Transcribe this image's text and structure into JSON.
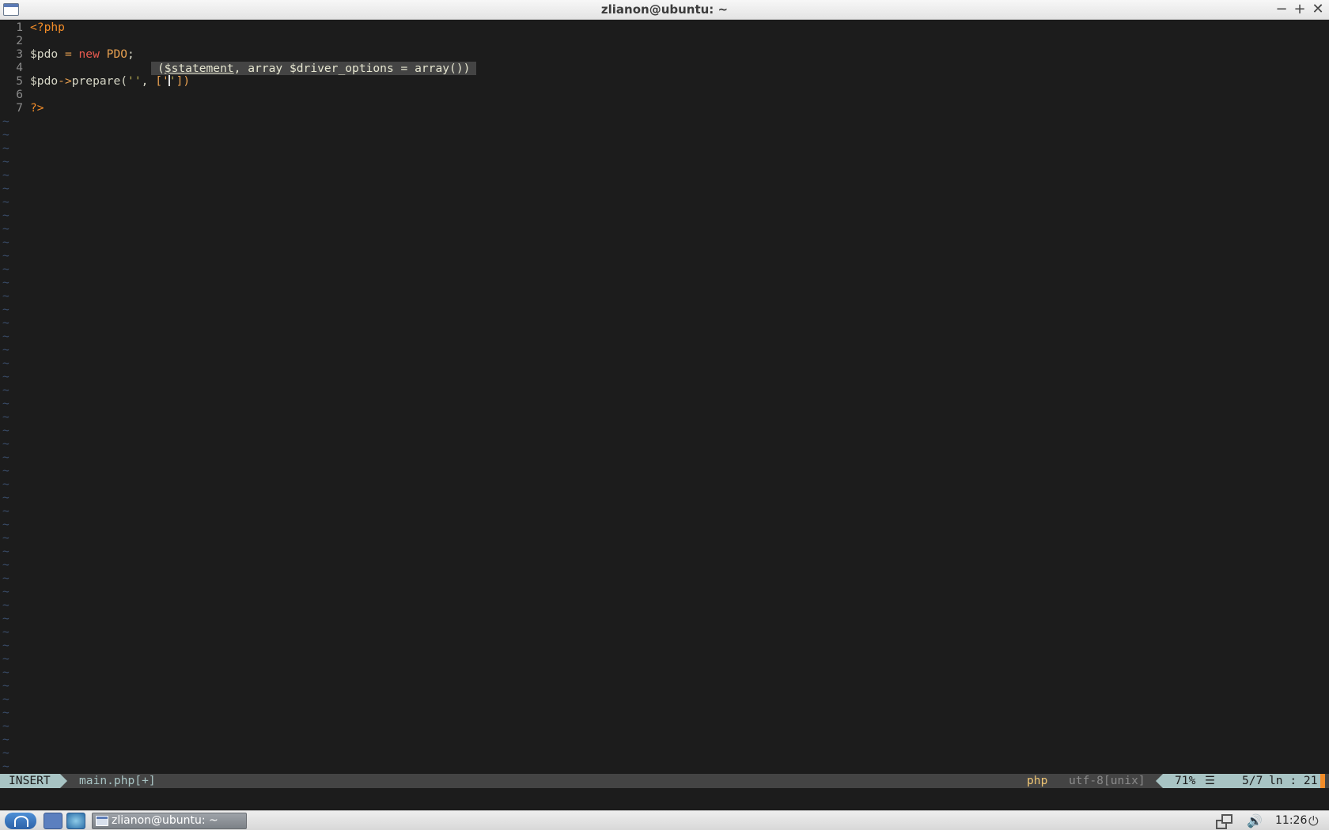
{
  "window": {
    "title": "zlianon@ubuntu: ~",
    "minimize": "−",
    "maximize": "+",
    "close": "✕"
  },
  "editor": {
    "lines": [
      {
        "num": "1",
        "tokens": [
          {
            "t": "<?php",
            "c": "kw-tag"
          }
        ]
      },
      {
        "num": "2",
        "tokens": []
      },
      {
        "num": "3",
        "tokens": [
          {
            "t": "$pdo",
            "c": "var"
          },
          {
            "t": " = ",
            "c": "op"
          },
          {
            "t": "new",
            "c": "kw-new"
          },
          {
            "t": " ",
            "c": "plain"
          },
          {
            "t": "PDO",
            "c": "cls"
          },
          {
            "t": ";",
            "c": "plain"
          }
        ]
      },
      {
        "num": "4",
        "tokens": []
      },
      {
        "num": "5",
        "tokens": [
          {
            "t": "$pdo",
            "c": "var"
          },
          {
            "t": "->",
            "c": "op"
          },
          {
            "t": "prepare",
            "c": "plain"
          },
          {
            "t": "(",
            "c": "plain"
          },
          {
            "t": "''",
            "c": "str"
          },
          {
            "t": ", ",
            "c": "plain"
          },
          {
            "t": "['",
            "c": "brk"
          },
          {
            "t": "CURSOR",
            "c": "cursor"
          },
          {
            "t": "'",
            "c": "str"
          },
          {
            "t": "])",
            "c": "brk"
          }
        ]
      },
      {
        "num": "6",
        "tokens": []
      },
      {
        "num": "7",
        "tokens": [
          {
            "t": "?>",
            "c": "kw-tag"
          }
        ]
      }
    ],
    "empty_marker": "~",
    "signature_hint": {
      "open": "(",
      "active_param": "$statement",
      "rest": ", array $driver_options = array())"
    }
  },
  "statusline": {
    "mode": "INSERT",
    "filename": "main.php[+]",
    "filetype": "php",
    "encoding": "utf-8[unix]",
    "percent": "71%",
    "menu_glyph": "☰",
    "position": "5/7",
    "column": "ln : 21"
  },
  "taskbar": {
    "task_label": "zlianon@ubuntu: ~",
    "clock": "11:26",
    "volume_glyph": "🔊",
    "power_glyph": "⏻"
  },
  "colors": {
    "background": "#1c1c1c",
    "statusline_accent": "#a8c4c4",
    "keyword_orange": "#f28c28",
    "new_keyword": "#e85a4f"
  }
}
